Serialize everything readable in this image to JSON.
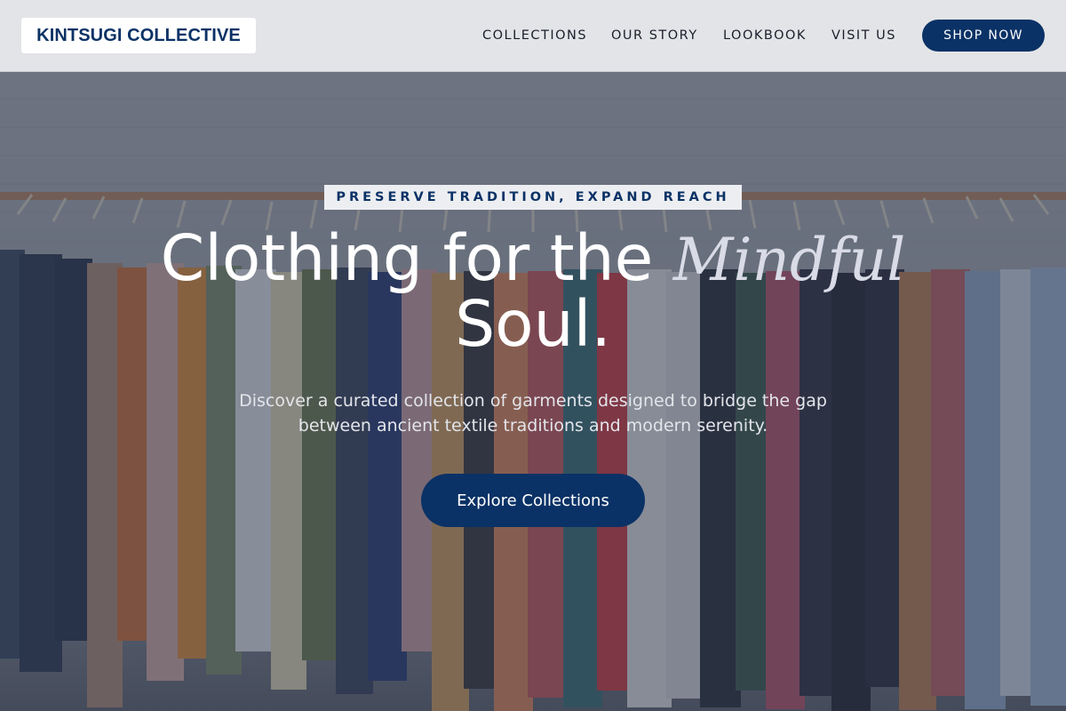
{
  "brand": {
    "logo_text": "KINTSUGI COLLECTIVE"
  },
  "nav": {
    "items": [
      {
        "label": "COLLECTIONS"
      },
      {
        "label": "OUR STORY"
      },
      {
        "label": "LOOKBOOK"
      },
      {
        "label": "VISIT US"
      }
    ],
    "cta_label": "SHOP NOW"
  },
  "hero": {
    "eyebrow": "PRESERVE TRADITION, EXPAND REACH",
    "headline_part1": "Clothing for the",
    "headline_emphasis": "Mindful",
    "headline_part2": "Soul.",
    "subtext": "Discover a curated collection of garments designed to bridge the gap between ancient textile traditions and modern serenity.",
    "cta_label": "Explore Collections",
    "image_subject": "clothing-rack-photo"
  },
  "colors": {
    "brand_navy": "#0b3266",
    "header_bg": "#e3e4e7",
    "hero_overlay": "#283042"
  }
}
